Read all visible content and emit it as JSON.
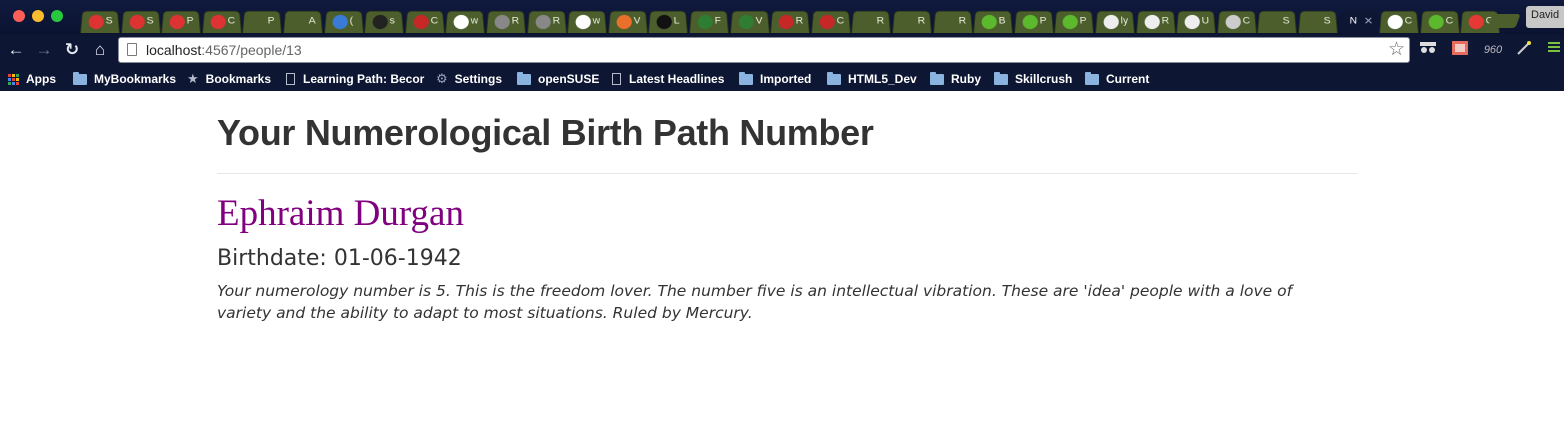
{
  "browser": {
    "tabs": [
      {
        "letter": "S",
        "icon": "red-circle",
        "color": "#d33"
      },
      {
        "letter": "S",
        "icon": "red-circle",
        "color": "#d33"
      },
      {
        "letter": "P",
        "icon": "red-circle",
        "color": "#d33"
      },
      {
        "letter": "C",
        "icon": "red-circle",
        "color": "#d33"
      },
      {
        "letter": "P",
        "icon": "blank",
        "color": ""
      },
      {
        "letter": "A",
        "icon": "blank",
        "color": ""
      },
      {
        "letter": "(",
        "icon": "blue-square",
        "color": "#3b7bd8"
      },
      {
        "letter": "s",
        "icon": "github",
        "color": "#222"
      },
      {
        "letter": "C",
        "icon": "red-box",
        "color": "#c62828"
      },
      {
        "letter": "w",
        "icon": "google",
        "color": "#fff"
      },
      {
        "letter": "R",
        "icon": "tree",
        "color": "#888"
      },
      {
        "letter": "R",
        "icon": "tree",
        "color": "#888"
      },
      {
        "letter": "w",
        "icon": "google",
        "color": "#fff"
      },
      {
        "letter": "V",
        "icon": "orange-q",
        "color": "#e8702a"
      },
      {
        "letter": "L",
        "icon": "black-g",
        "color": "#111"
      },
      {
        "letter": "F",
        "icon": "green-grid",
        "color": "#2e7d32"
      },
      {
        "letter": "V",
        "icon": "green-grid",
        "color": "#2e7d32"
      },
      {
        "letter": "R",
        "icon": "rp",
        "color": "#c62828"
      },
      {
        "letter": "C",
        "icon": "rp",
        "color": "#c62828"
      },
      {
        "letter": "R",
        "icon": "blank",
        "color": ""
      },
      {
        "letter": "R",
        "icon": "blank",
        "color": ""
      },
      {
        "letter": "R",
        "icon": "blank",
        "color": ""
      },
      {
        "letter": "B",
        "icon": "green-u",
        "color": "#5cb82d"
      },
      {
        "letter": "P",
        "icon": "green-u",
        "color": "#5cb82d"
      },
      {
        "letter": "P",
        "icon": "green-u",
        "color": "#5cb82d"
      },
      {
        "letter": "ly",
        "icon": "panda",
        "color": "#eee"
      },
      {
        "letter": "R",
        "icon": "panda",
        "color": "#eee"
      },
      {
        "letter": "U",
        "icon": "panda",
        "color": "#eee"
      },
      {
        "letter": "C",
        "icon": "gray-o",
        "color": "#ccc"
      },
      {
        "letter": "S",
        "icon": "blank",
        "color": ""
      },
      {
        "letter": "S",
        "icon": "blank",
        "color": ""
      },
      {
        "letter": "N",
        "icon": "active",
        "color": ""
      },
      {
        "letter": "C",
        "icon": "google",
        "color": "#fff"
      },
      {
        "letter": "C",
        "icon": "green-arrow",
        "color": "#5cb82d"
      },
      {
        "letter": "G",
        "icon": "red-f",
        "color": "#e53935"
      }
    ],
    "profile_name": "David",
    "url_host": "localhost",
    "url_rest": ":4567/people/13",
    "bookmarks": [
      {
        "label": "Apps",
        "icon": "apps-grid-icon"
      },
      {
        "label": "MyBookmarks",
        "icon": "folder-icon"
      },
      {
        "label": "Bookmarks",
        "icon": "star-icon"
      },
      {
        "label": "Learning Path: Becor",
        "icon": "page-icon"
      },
      {
        "label": "Settings",
        "icon": "gear-icon"
      },
      {
        "label": "openSUSE",
        "icon": "folder-icon"
      },
      {
        "label": "Latest Headlines",
        "icon": "page-icon"
      },
      {
        "label": "Imported",
        "icon": "folder-icon"
      },
      {
        "label": "HTML5_Dev",
        "icon": "folder-icon"
      },
      {
        "label": "Ruby",
        "icon": "folder-icon"
      },
      {
        "label": "Skillcrush",
        "icon": "folder-icon"
      },
      {
        "label": "Current",
        "icon": "folder-icon"
      }
    ],
    "extensions": [
      "spy-icon",
      "film-icon",
      "960-icon",
      "wand-icon",
      "menu-icon"
    ],
    "ext_960_label": "960"
  },
  "page": {
    "title": "Your Numerological Birth Path Number",
    "person_name": "Ephraim Durgan",
    "birthdate": "Birthdate: 01-06-1942",
    "reading": "Your numerology number is 5. This is the freedom lover. The number five is an intellectual vibration. These are 'idea' people with a love of variety and the ability to adapt to most situations. Ruled by Mercury."
  },
  "colors": {
    "name_color": "#800080",
    "text_color": "#333333",
    "chrome_bg": "#0d1633"
  }
}
